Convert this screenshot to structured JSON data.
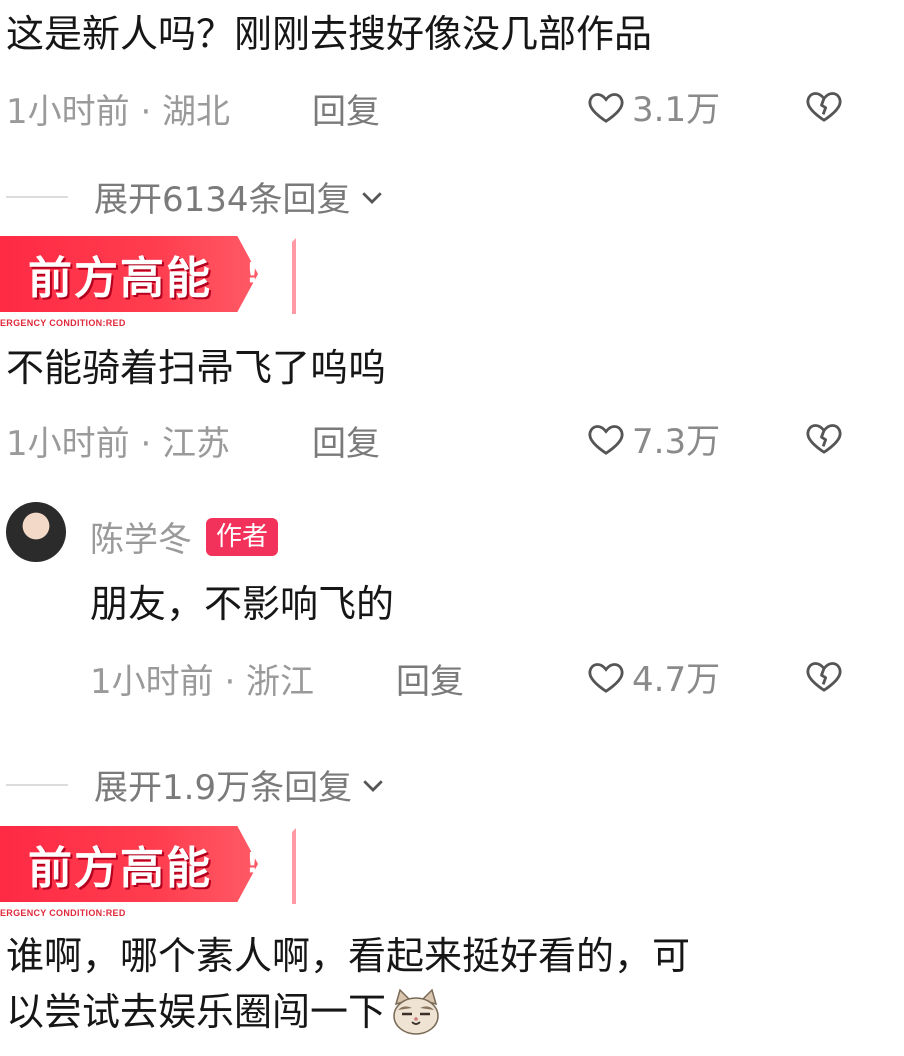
{
  "comments": [
    {
      "text": "这是新人吗？刚刚去搜好像没几部作品",
      "meta": "1小时前 · 湖北",
      "reply_label": "回复",
      "likes": "3.1万"
    },
    {
      "badge": {
        "title": "前方高能",
        "mark": "!",
        "subtitle": "ERGENCY  CONDITION:RED"
      },
      "text": "不能骑着扫帚飞了呜呜",
      "meta": "1小时前 · 江苏",
      "reply_label": "回复",
      "likes": "7.3万"
    },
    {
      "badge": {
        "title": "前方高能",
        "mark": "!",
        "subtitle": "ERGENCY  CONDITION:RED"
      },
      "text_line1": "谁啊，哪个素人啊，看起来挺好看的，可",
      "text_line2": "以尝试去娱乐圈闯一下",
      "emoji_icon": "cat-face-emoji-icon"
    }
  ],
  "expand_replies": [
    {
      "label": "展开6134条回复"
    },
    {
      "label": "展开1.9万条回复"
    }
  ],
  "author_reply": {
    "name": "陈学冬",
    "tag": "作者",
    "text": "朋友，不影响飞的",
    "meta": "1小时前 · 浙江",
    "reply_label": "回复",
    "likes": "4.7万"
  },
  "icons": {
    "like": "heart-outline-icon",
    "dislike": "broken-heart-icon",
    "expand": "chevron-down-icon"
  },
  "colors": {
    "badge_red": "#ff2a44",
    "author_tag": "#f2325a",
    "meta_gray": "#9a9a9a"
  }
}
